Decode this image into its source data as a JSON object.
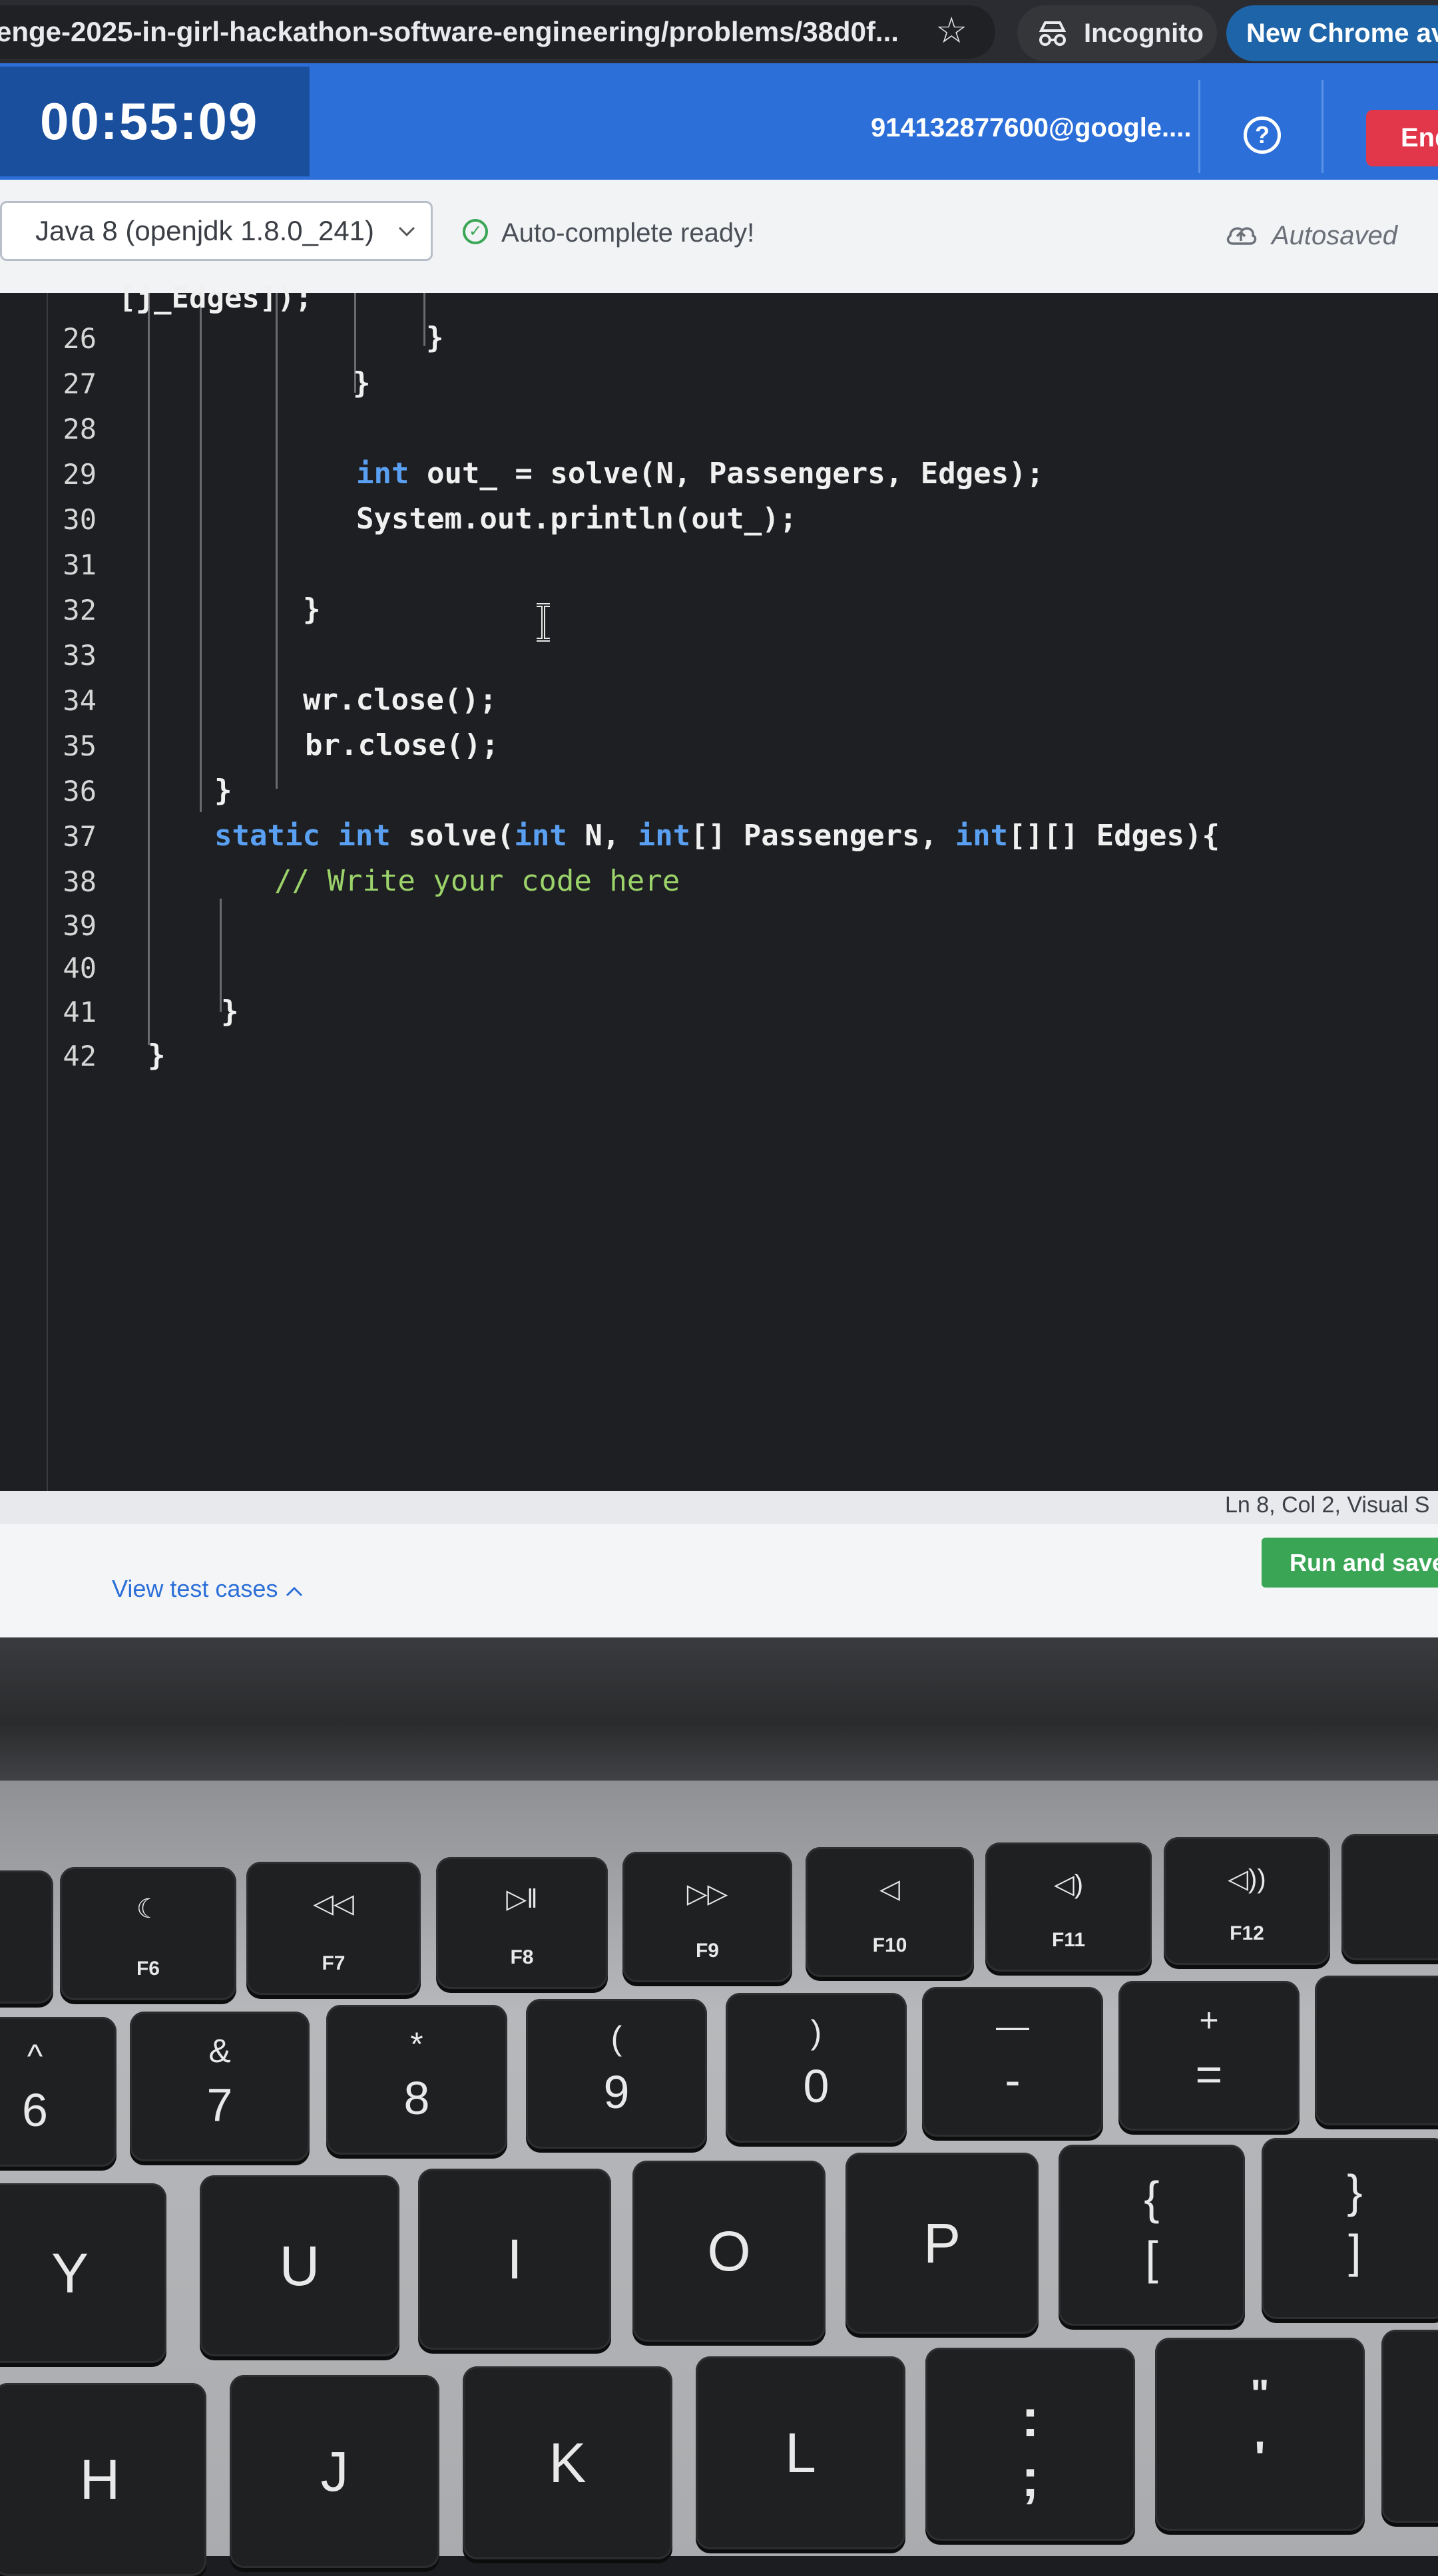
{
  "browser": {
    "url": "enge-2025-in-girl-hackathon-software-engineering/problems/38d0f...",
    "incognito_label": "Incognito",
    "new_chrome_label": "New Chrome ava"
  },
  "header": {
    "timer": "00:55:09",
    "email": "91413287760​0@google....",
    "help_label": "?",
    "end_label": "End"
  },
  "toolbar": {
    "language": "Java 8 (openjdk 1.8.0_241)",
    "autocomplete_status": "Auto-complete ready!",
    "autosave_status": "Autosaved"
  },
  "editor": {
    "partial_line": "[j_Edges]);",
    "lines": [
      {
        "num": "26",
        "text": "}"
      },
      {
        "num": "27",
        "text": "}"
      },
      {
        "num": "28",
        "text": ""
      },
      {
        "num": "29",
        "kw": "int",
        "text": " out_ = solve(N, Passengers, Edges);"
      },
      {
        "num": "30",
        "text": "System.out.println(out_);"
      },
      {
        "num": "31",
        "text": ""
      },
      {
        "num": "32",
        "text": "}"
      },
      {
        "num": "33",
        "text": ""
      },
      {
        "num": "34",
        "text": "wr.close();"
      },
      {
        "num": "35",
        "text": "br.close();"
      },
      {
        "num": "36",
        "text": "}"
      },
      {
        "num": "37",
        "kw": "static int",
        "text": " solve(",
        "kw2": "int",
        "text2": " N, ",
        "kw3": "int",
        "text3": "[] Passengers, ",
        "kw4": "int",
        "text4": "[][] Edges){"
      },
      {
        "num": "38",
        "comment": "// Write your code here"
      },
      {
        "num": "39",
        "text": ""
      },
      {
        "num": "40",
        "text": ""
      },
      {
        "num": "41",
        "text": "}"
      },
      {
        "num": "42",
        "text": "}"
      }
    ]
  },
  "status": {
    "cursor_position": "Ln 8, Col 2, Visual S"
  },
  "footer": {
    "view_test_cases": "View test cases",
    "run_and_save": "Run and save"
  },
  "keyboard": {
    "fn_row": [
      "F6",
      "F7",
      "F8",
      "F9",
      "F10",
      "F11",
      "F12"
    ],
    "num_row": [
      {
        "top": "^",
        "bot": "6"
      },
      {
        "top": "&",
        "bot": "7"
      },
      {
        "top": "*",
        "bot": "8"
      },
      {
        "top": "(",
        "bot": "9"
      },
      {
        "top": ")",
        "bot": "0"
      },
      {
        "top": "—",
        "bot": "-"
      },
      {
        "top": "+",
        "bot": "="
      }
    ],
    "letter_row1": [
      "Y",
      "U",
      "I",
      "O",
      "P"
    ],
    "bracket_keys": [
      {
        "top": "{",
        "bot": "["
      },
      {
        "top": "}",
        "bot": "]"
      }
    ],
    "letter_row2": [
      "H",
      "J",
      "K",
      "L"
    ],
    "punct_keys": [
      {
        "top": ":",
        "bot": ";"
      },
      {
        "top": "\"",
        "bot": "'"
      }
    ]
  }
}
